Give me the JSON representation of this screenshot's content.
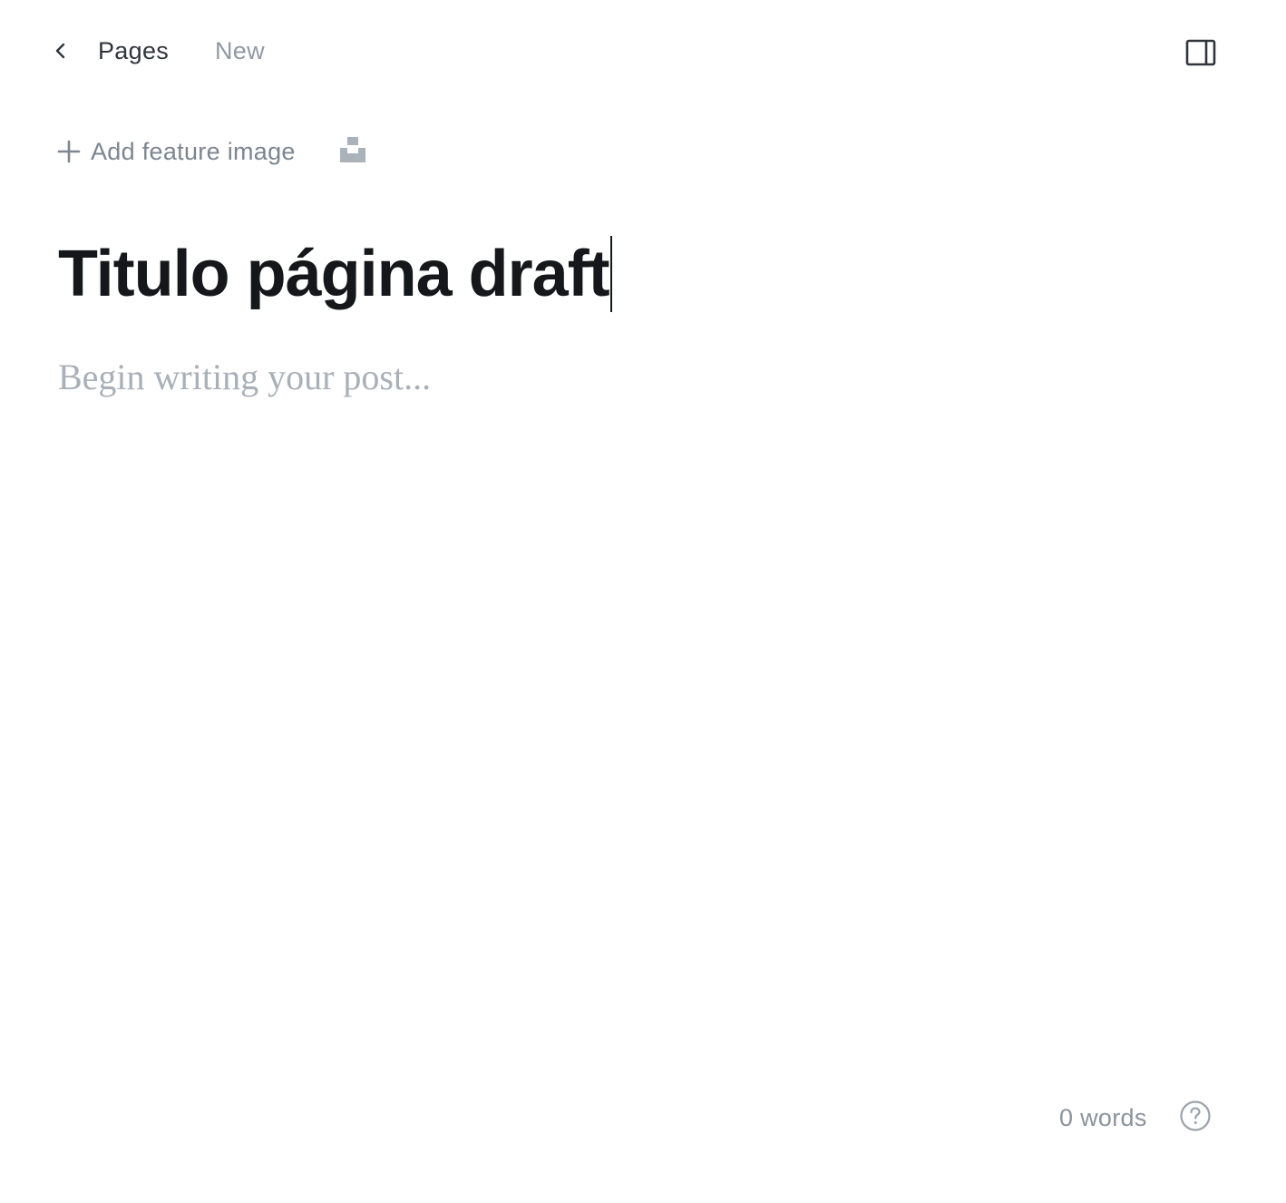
{
  "header": {
    "back_icon": "chevron-left-icon",
    "breadcrumb_label": "Pages",
    "status_label": "New",
    "sidebar_toggle_icon": "sidebar-panel-icon"
  },
  "feature_image": {
    "plus_icon": "plus-icon",
    "label": "Add feature image",
    "unsplash_icon": "unsplash-icon"
  },
  "editor": {
    "title_value": "Titulo página draft",
    "body_placeholder": "Begin writing your post..."
  },
  "footer": {
    "word_count": "0 words",
    "help_icon": "help-circle-icon"
  },
  "colors": {
    "text_dark": "#15171a",
    "text_muted": "#7c8590",
    "placeholder": "#a9b0b8",
    "background": "#ffffff"
  }
}
